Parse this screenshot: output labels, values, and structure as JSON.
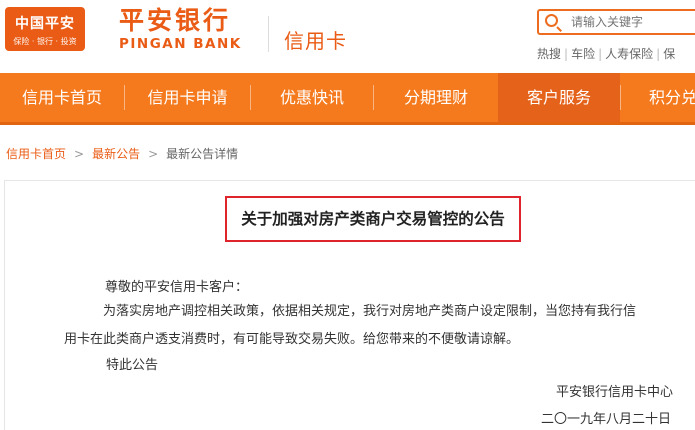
{
  "header": {
    "logo": {
      "main": "中国平安",
      "sub": "保险 · 银行 · 投资"
    },
    "bank_name_cn": "平安银行",
    "bank_name_en": "PINGAN BANK",
    "section_title": "信用卡",
    "search": {
      "placeholder": "请输入关键字"
    },
    "hot_links": [
      "热搜",
      "车险",
      "人寿保险",
      "保"
    ]
  },
  "nav": {
    "items": [
      {
        "label": "信用卡首页"
      },
      {
        "label": "信用卡申请"
      },
      {
        "label": "优惠快讯"
      },
      {
        "label": "分期理财"
      },
      {
        "label": "客户服务",
        "active": true
      },
      {
        "label": "积分兑"
      }
    ]
  },
  "breadcrumb": {
    "items": [
      "信用卡首页",
      "最新公告",
      "最新公告详情"
    ]
  },
  "notice": {
    "title": "关于加强对房产类商户交易管控的公告",
    "greeting": "尊敬的平安信用卡客户：",
    "body_line1": "为落实房地产调控相关政策，依据相关规定，我行对房地产类商户设定限制，当您持有我行信",
    "body_line2": "用卡在此类商户透支消费时，有可能导致交易失败。给您带来的不便敬请谅解。",
    "closing": "特此公告",
    "signature": "平安银行信用卡中心",
    "date": "二〇一九年八月二十日"
  },
  "colors": {
    "brand_orange": "#f57a1d",
    "active_nav": "#e5621a",
    "title_border": "#e0242b"
  }
}
